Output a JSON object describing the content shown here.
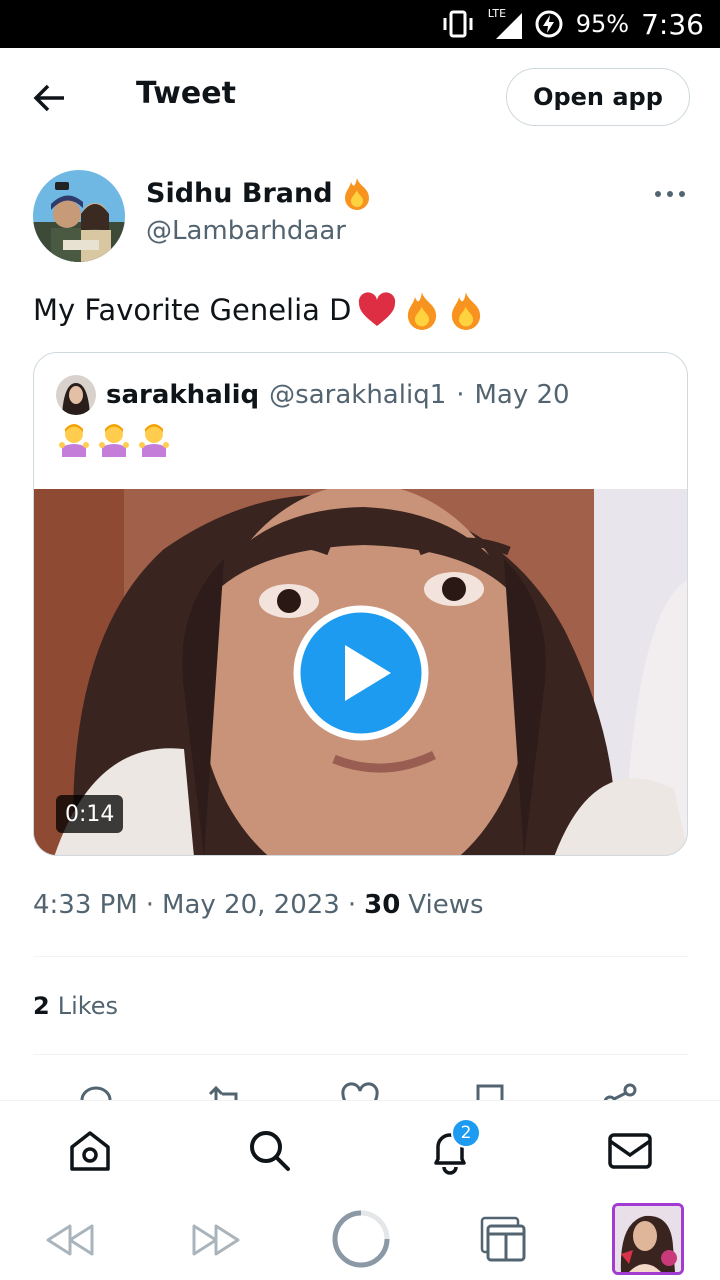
{
  "status_bar": {
    "network": "LTE",
    "battery_pct": "95%",
    "time": "7:36"
  },
  "header": {
    "title": "Tweet",
    "open_app_label": "Open app"
  },
  "tweet": {
    "author_name": "Sidhu Brand",
    "author_handle": "@Lambarhdaar",
    "text": "My Favorite Genelia D",
    "text_emojis": [
      "heart",
      "fire",
      "fire"
    ],
    "quote": {
      "name": "sarakhaliq",
      "handle": "@sarakhaliq1",
      "separator": "·",
      "date": "May 20",
      "emojis": [
        "person-shrugging",
        "person-shrugging",
        "person-shrugging"
      ],
      "video_duration": "0:14"
    },
    "time": "4:33 PM",
    "date": "May 20, 2023",
    "views_count": "30",
    "views_label": "Views",
    "likes_count": "2",
    "likes_label": "Likes"
  },
  "bottom_nav": {
    "items": [
      "home-icon",
      "search-icon",
      "notifications-icon",
      "messages-icon"
    ],
    "notifications_badge": "2"
  },
  "browser_bar": {
    "items": [
      "back-icon",
      "forward-icon",
      "reload-icon",
      "tabs-icon"
    ]
  },
  "colors": {
    "accent": "#1d9bf0",
    "text_primary": "#0f1419",
    "text_secondary": "#536471",
    "border": "#cfd9de",
    "divider": "#eff3f4"
  }
}
